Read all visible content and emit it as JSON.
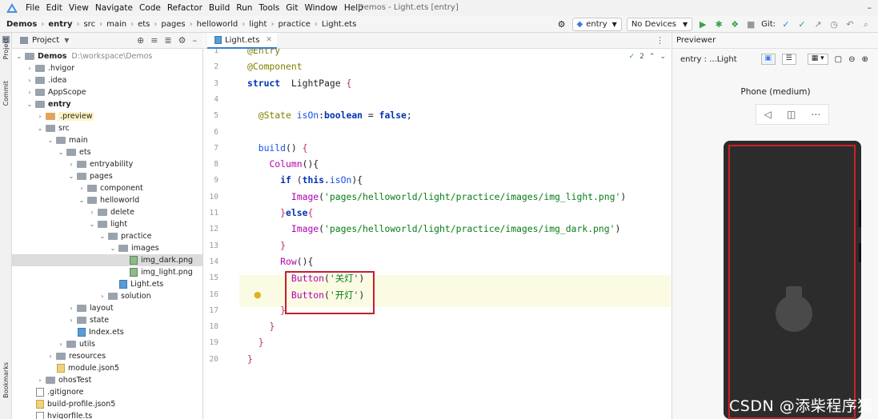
{
  "menubar": {
    "items": [
      "File",
      "Edit",
      "View",
      "Navigate",
      "Code",
      "Refactor",
      "Build",
      "Run",
      "Tools",
      "Git",
      "Window",
      "Help"
    ],
    "window_title": "Demos - Light.ets [entry]"
  },
  "navbar": {
    "crumbs": [
      "Demos",
      "entry",
      "src",
      "main",
      "ets",
      "pages",
      "helloworld",
      "light",
      "practice",
      "Light.ets"
    ],
    "module_combo": "entry",
    "device_combo": "No Devices",
    "git_label": "Git:"
  },
  "side_strip": {
    "project": "Project",
    "commit": "Commit",
    "bookmarks": "Bookmarks"
  },
  "project_panel": {
    "title": "Project"
  },
  "tree": [
    {
      "depth": 0,
      "arrow": "v",
      "icon": "folder-gray",
      "label": "Demos",
      "extra": "D:\\workspace\\Demos",
      "bold": true
    },
    {
      "depth": 1,
      "arrow": ">",
      "icon": "folder-gray",
      "label": ".hvigor"
    },
    {
      "depth": 1,
      "arrow": ">",
      "icon": "folder-gray",
      "label": ".idea"
    },
    {
      "depth": 1,
      "arrow": ">",
      "icon": "folder-gray",
      "label": "AppScope"
    },
    {
      "depth": 1,
      "arrow": "v",
      "icon": "folder-gray",
      "label": "entry",
      "bold": true
    },
    {
      "depth": 2,
      "arrow": ">",
      "icon": "folder-orange",
      "label": ".preview",
      "yellowbg": true
    },
    {
      "depth": 2,
      "arrow": "v",
      "icon": "folder-gray",
      "label": "src"
    },
    {
      "depth": 3,
      "arrow": "v",
      "icon": "folder-gray",
      "label": "main"
    },
    {
      "depth": 4,
      "arrow": "v",
      "icon": "folder-gray",
      "label": "ets"
    },
    {
      "depth": 5,
      "arrow": ">",
      "icon": "folder-gray",
      "label": "entryability"
    },
    {
      "depth": 5,
      "arrow": "v",
      "icon": "folder-gray",
      "label": "pages"
    },
    {
      "depth": 6,
      "arrow": ">",
      "icon": "folder-gray",
      "label": "component"
    },
    {
      "depth": 6,
      "arrow": "v",
      "icon": "folder-gray",
      "label": "helloworld"
    },
    {
      "depth": 7,
      "arrow": ">",
      "icon": "folder-gray",
      "label": "delete"
    },
    {
      "depth": 7,
      "arrow": "v",
      "icon": "folder-gray",
      "label": "light"
    },
    {
      "depth": 8,
      "arrow": "v",
      "icon": "folder-gray",
      "label": "practice"
    },
    {
      "depth": 9,
      "arrow": "v",
      "icon": "folder-gray",
      "label": "images"
    },
    {
      "depth": 10,
      "arrow": "",
      "icon": "file-img",
      "label": "img_dark.png",
      "selected": true
    },
    {
      "depth": 10,
      "arrow": "",
      "icon": "file-img",
      "label": "img_light.png"
    },
    {
      "depth": 9,
      "arrow": "",
      "icon": "file-ets",
      "label": "Light.ets"
    },
    {
      "depth": 8,
      "arrow": ">",
      "icon": "folder-gray",
      "label": "solution"
    },
    {
      "depth": 5,
      "arrow": ">",
      "icon": "folder-gray",
      "label": "layout"
    },
    {
      "depth": 5,
      "arrow": ">",
      "icon": "folder-gray",
      "label": "state"
    },
    {
      "depth": 5,
      "arrow": "",
      "icon": "file-ets",
      "label": "Index.ets"
    },
    {
      "depth": 4,
      "arrow": ">",
      "icon": "folder-gray",
      "label": "utils"
    },
    {
      "depth": 3,
      "arrow": ">",
      "icon": "folder-gray",
      "label": "resources"
    },
    {
      "depth": 3,
      "arrow": "",
      "icon": "file-json",
      "label": "module.json5"
    },
    {
      "depth": 2,
      "arrow": ">",
      "icon": "folder-gray",
      "label": "ohosTest"
    },
    {
      "depth": 1,
      "arrow": "",
      "icon": "file",
      "label": ".gitignore"
    },
    {
      "depth": 1,
      "arrow": "",
      "icon": "file-json",
      "label": "build-profile.json5"
    },
    {
      "depth": 1,
      "arrow": "",
      "icon": "file",
      "label": "hvigorfile.ts"
    }
  ],
  "editor": {
    "tab_label": "Light.ets",
    "inspection_count": "2",
    "lines": [
      {
        "n": "1",
        "tokens": [
          [
            "an",
            "@Entry"
          ]
        ]
      },
      {
        "n": "2",
        "tokens": [
          [
            "an",
            "@Component"
          ]
        ]
      },
      {
        "n": "3",
        "tokens": [
          [
            "kw",
            "struct"
          ],
          [
            "",
            "  LightPage "
          ],
          [
            "br",
            "{"
          ]
        ]
      },
      {
        "n": "4",
        "tokens": []
      },
      {
        "n": "5",
        "tokens": [
          [
            "",
            "  "
          ],
          [
            "an",
            "@State "
          ],
          [
            "id",
            "isOn"
          ],
          [
            "",
            ":"
          ],
          [
            "kw",
            "boolean"
          ],
          [
            "",
            " = "
          ],
          [
            "kw",
            "false"
          ],
          [
            "",
            ";"
          ]
        ]
      },
      {
        "n": "6",
        "tokens": []
      },
      {
        "n": "7",
        "tokens": [
          [
            "",
            "  "
          ],
          [
            "id",
            "build"
          ],
          [
            "",
            "() "
          ],
          [
            "br",
            "{"
          ]
        ]
      },
      {
        "n": "8",
        "tokens": [
          [
            "",
            "    "
          ],
          [
            "fn",
            "Column"
          ],
          [
            "",
            "(){"
          ]
        ]
      },
      {
        "n": "9",
        "tokens": [
          [
            "",
            "      "
          ],
          [
            "kw",
            "if"
          ],
          [
            "",
            " ("
          ],
          [
            "kw",
            "this"
          ],
          [
            "",
            "."
          ],
          [
            "id",
            "isOn"
          ],
          [
            "",
            "){"
          ]
        ]
      },
      {
        "n": "10",
        "tokens": [
          [
            "",
            "        "
          ],
          [
            "fn",
            "Image"
          ],
          [
            "",
            "("
          ],
          [
            "str",
            "'pages/helloworld/light/practice/images/img_light.png'"
          ],
          [
            "",
            ")"
          ]
        ]
      },
      {
        "n": "11",
        "tokens": [
          [
            "",
            "      "
          ],
          [
            "br",
            "}"
          ],
          [
            "kw",
            "else"
          ],
          [
            "br",
            "{"
          ]
        ]
      },
      {
        "n": "12",
        "tokens": [
          [
            "",
            "        "
          ],
          [
            "fn",
            "Image"
          ],
          [
            "",
            "("
          ],
          [
            "str",
            "'pages/helloworld/light/practice/images/img_dark.png'"
          ],
          [
            "",
            ")"
          ]
        ]
      },
      {
        "n": "13",
        "tokens": [
          [
            "",
            "      "
          ],
          [
            "br",
            "}"
          ]
        ]
      },
      {
        "n": "14",
        "tokens": [
          [
            "",
            "      "
          ],
          [
            "fn",
            "Row"
          ],
          [
            "",
            "(){"
          ]
        ]
      },
      {
        "n": "15",
        "tokens": [
          [
            "",
            "        "
          ],
          [
            "fn",
            "Button"
          ],
          [
            "",
            "("
          ],
          [
            "str",
            "'关灯'"
          ],
          [
            "",
            ")"
          ]
        ]
      },
      {
        "n": "16",
        "tokens": [
          [
            "",
            "        "
          ],
          [
            "fn",
            "Button"
          ],
          [
            "",
            "("
          ],
          [
            "str",
            "'开灯'"
          ],
          [
            "",
            ")"
          ]
        ]
      },
      {
        "n": "17",
        "tokens": [
          [
            "",
            "      "
          ],
          [
            "br",
            "}"
          ]
        ]
      },
      {
        "n": "18",
        "tokens": [
          [
            "",
            "    "
          ],
          [
            "br",
            "}"
          ]
        ]
      },
      {
        "n": "19",
        "tokens": [
          [
            "",
            "  "
          ],
          [
            "br",
            "}"
          ]
        ]
      },
      {
        "n": "20",
        "tokens": [
          [
            "br",
            "}"
          ]
        ]
      }
    ]
  },
  "previewer": {
    "title": "Previewer",
    "entry_label": "entry : ...Light",
    "device_label": "Phone (medium)"
  },
  "watermark": "CSDN @添柴程序猿"
}
